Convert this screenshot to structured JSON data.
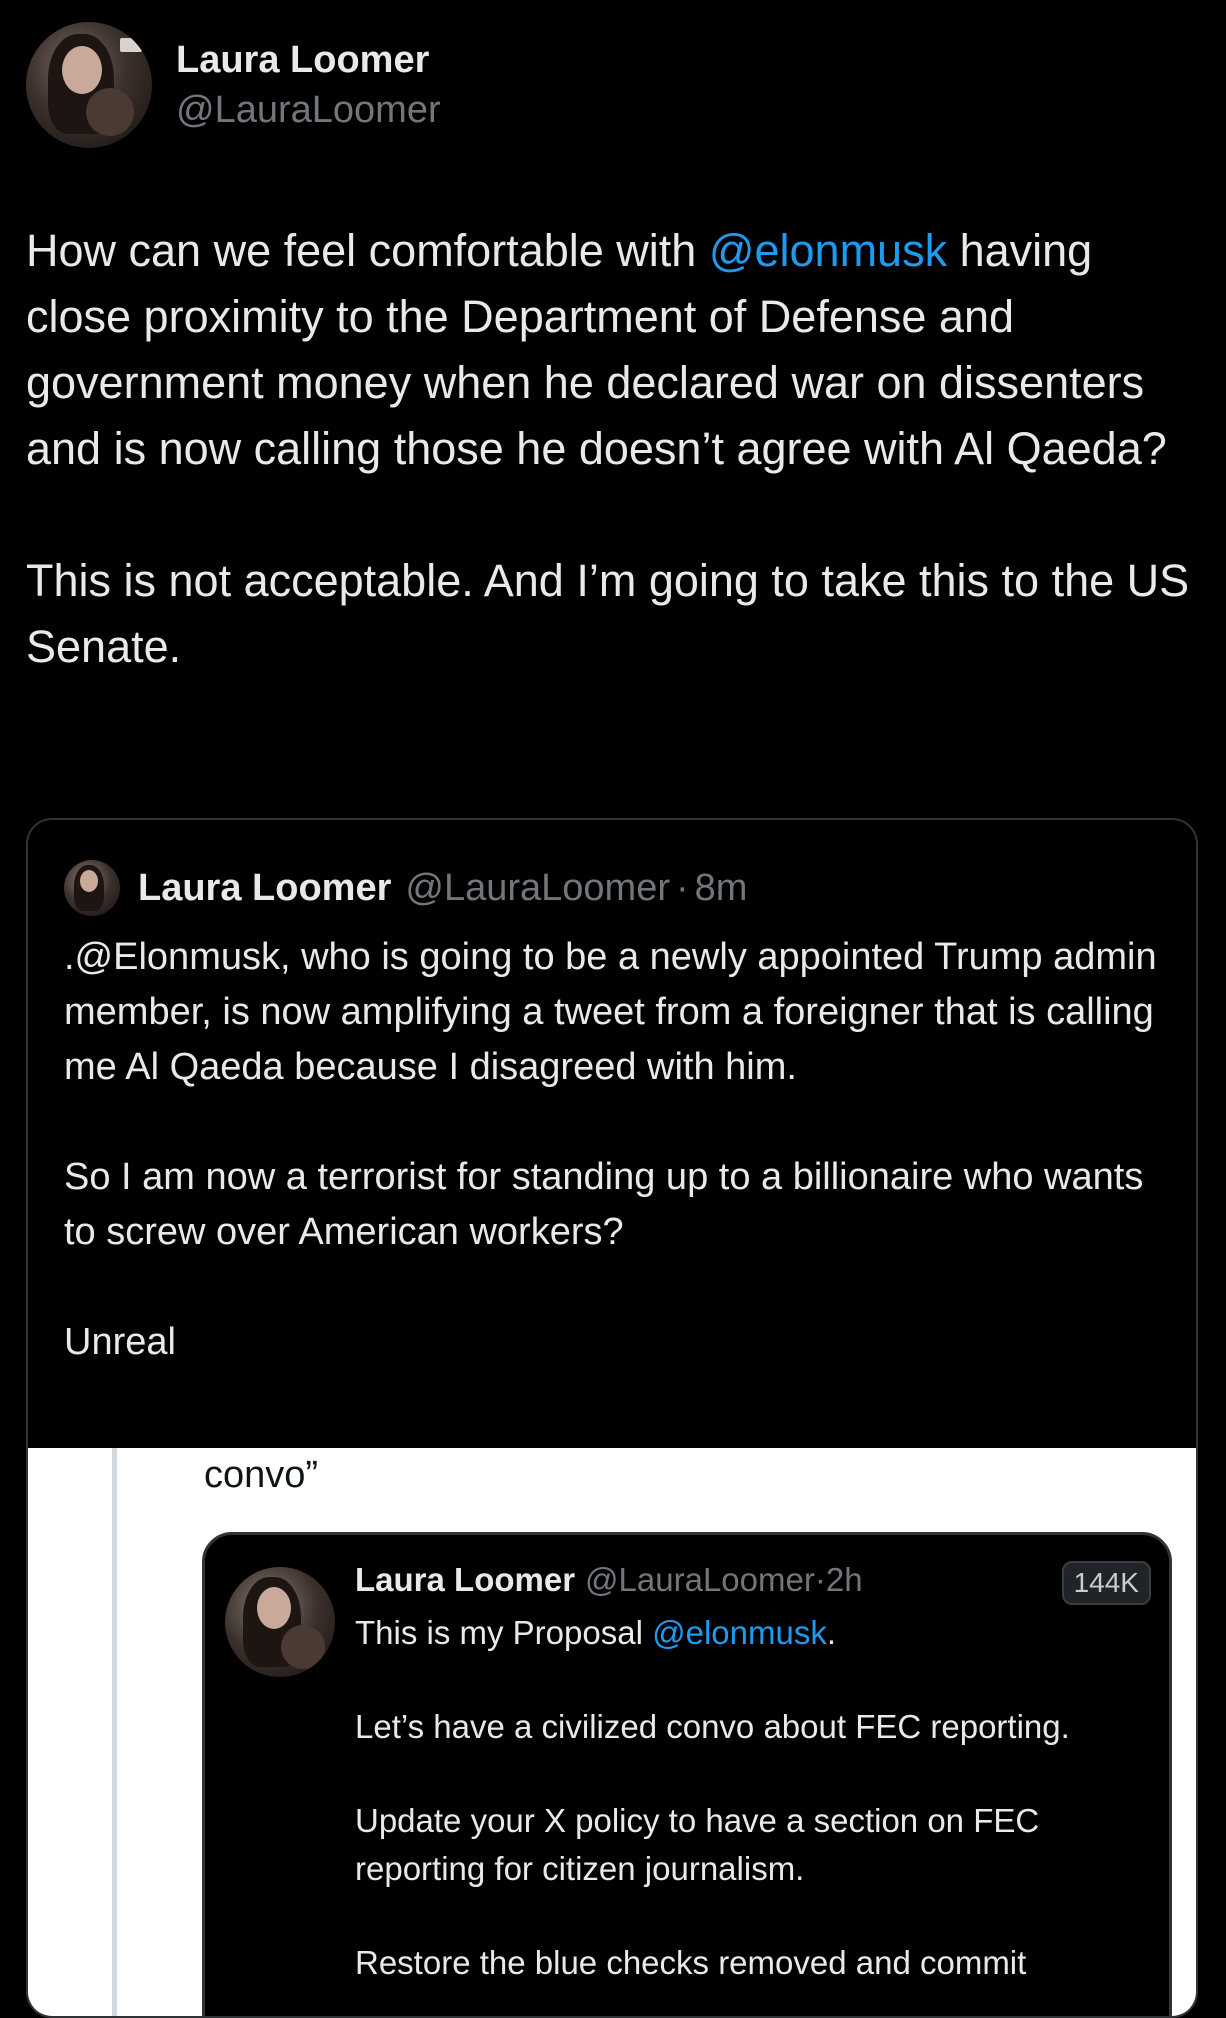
{
  "author": {
    "display_name": "Laura Loomer",
    "handle": "@LauraLoomer"
  },
  "tweet": {
    "p1_before": "How can we feel comfortable with ",
    "p1_mention": "@elonmusk",
    "p1_after": " having close proximity to the Department of Defense and government money when he declared war on dissenters and is now calling those he doesn’t agree with Al Qaeda?",
    "p2": "This is not acceptable. And I’m going to take this to the US Senate."
  },
  "quoted_tweet": {
    "display_name": "Laura Loomer",
    "handle": "@LauraLoomer",
    "separator": "·",
    "time": "8m",
    "p1": ".@Elonmusk, who is going to be a newly appointed Trump admin member, is now amplifying a tweet from a foreigner that is calling me Al Qaeda because I disagreed with him.",
    "p2": "So I am now a terrorist for standing up to a billionaire who wants to screw over American workers?",
    "p3": "Unreal"
  },
  "embedded_screenshot": {
    "convo_text": "convo”",
    "inner_tweet": {
      "display_name": "Laura Loomer",
      "handle": "@LauraLoomer",
      "separator": "·",
      "time": "2h",
      "views": "144K",
      "line1_before": "This is my Proposal ",
      "line1_mention": "@elonmusk",
      "line1_after": ".",
      "p2": "Let’s have a civilized convo about FEC reporting.",
      "p3": "Update your X policy to have a section on FEC reporting for citizen journalism.",
      "p4": "Restore the blue checks removed and commit"
    }
  },
  "colors": {
    "background": "#000000",
    "text": "#e7e9ea",
    "secondary": "#71767b",
    "mention": "#1d9bf0"
  }
}
